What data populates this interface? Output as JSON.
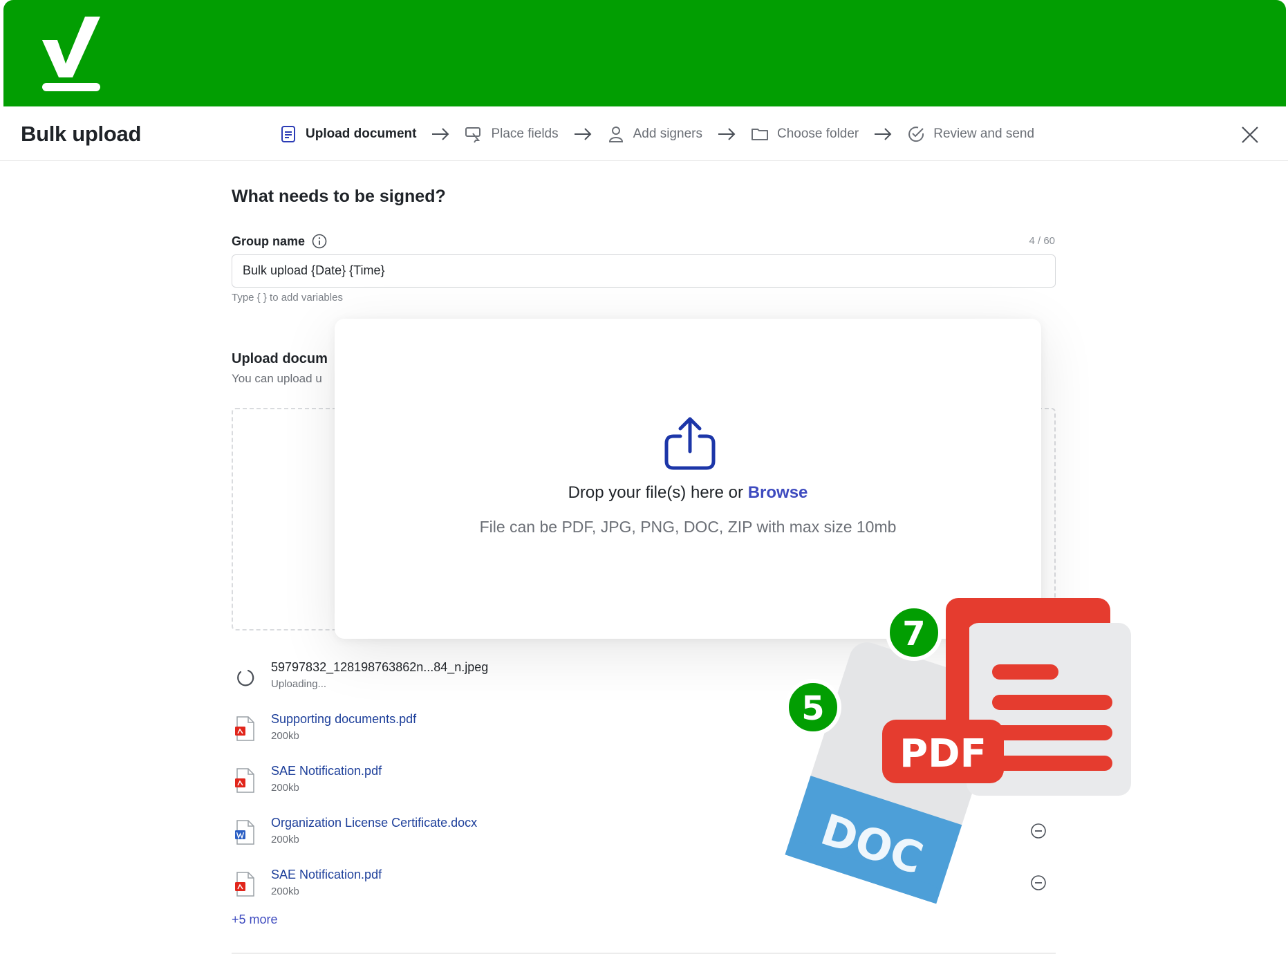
{
  "brand": {
    "color": "#029e02"
  },
  "header": {
    "title": "Bulk upload",
    "steps": [
      {
        "label": "Upload document",
        "icon": "document-icon",
        "active": true
      },
      {
        "label": "Place fields",
        "icon": "place-fields-icon",
        "active": false
      },
      {
        "label": "Add signers",
        "icon": "user-icon",
        "active": false
      },
      {
        "label": "Choose folder",
        "icon": "folder-icon",
        "active": false
      },
      {
        "label": "Review and send",
        "icon": "check-circle-icon",
        "active": false
      }
    ],
    "close_icon": "close-icon"
  },
  "form": {
    "question": "What needs to be signed?",
    "group_label": "Group name",
    "counter": "4 / 60",
    "group_value": "Bulk upload {Date} {Time}",
    "hint": "Type { } to add variables",
    "upload_title": "Upload docum",
    "upload_sub": "You can upload u"
  },
  "dropzone": {
    "text": "Drop your file(s) here or ",
    "browse": "Browse",
    "sub": "File can be PDF, JPG, PNG, DOC, ZIP with max size 10mb"
  },
  "files": [
    {
      "name": "59797832_128198763862n...84_n.jpeg",
      "meta": "Uploading...",
      "type": "uploading"
    },
    {
      "name": "Supporting documents.pdf",
      "meta": "200kb",
      "type": "pdf"
    },
    {
      "name": "SAE Notification.pdf",
      "meta": "200kb",
      "type": "pdf"
    },
    {
      "name": "Organization License Certificate.docx",
      "meta": "200kb",
      "type": "docx"
    },
    {
      "name": "SAE Notification.pdf",
      "meta": "200kb",
      "type": "pdf"
    }
  ],
  "more": "+5 more",
  "illustration": {
    "doc_count": "5",
    "pdf_count": "7",
    "doc_label": "DOC",
    "pdf_label": "PDF"
  }
}
